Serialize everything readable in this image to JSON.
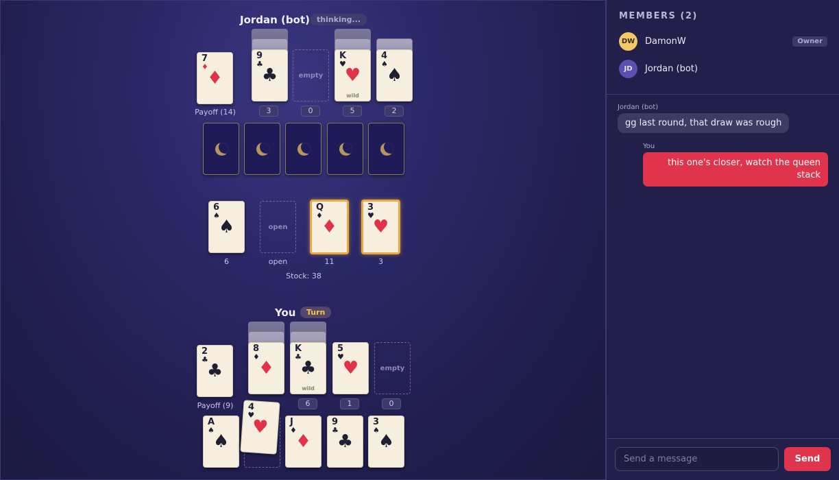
{
  "opponent": {
    "name": "Jordan (bot)",
    "status": "thinking...",
    "payoff_label": "Payoff (14)",
    "payoff_card": {
      "rank": "7",
      "suit": "♦",
      "color": "red"
    },
    "stacks": [
      {
        "rank": "9",
        "suit": "♣",
        "color": "black",
        "wild": "",
        "count": "3"
      },
      {
        "slot": "empty",
        "count": "0"
      },
      {
        "rank": "K",
        "suit": "♥",
        "color": "red",
        "wild": "wild",
        "count": "5"
      },
      {
        "rank": "4",
        "suit": "♠",
        "color": "black",
        "wild": "",
        "count": "2"
      }
    ],
    "hand_backs": 5,
    "back_icon": "crescent-moon-icon"
  },
  "build_piles": [
    {
      "rank": "6",
      "suit": "♠",
      "color": "black",
      "caption": "6"
    },
    {
      "slot": "open",
      "caption": "open"
    },
    {
      "rank": "Q",
      "suit": "♦",
      "color": "red",
      "caption": "11",
      "highlight": true
    },
    {
      "rank": "3",
      "suit": "♥",
      "color": "red",
      "caption": "3",
      "highlight": true
    }
  ],
  "stock_label": "Stock: 38",
  "player": {
    "name": "You",
    "status": "Turn",
    "payoff_label": "Payoff (9)",
    "payoff_card": {
      "rank": "2",
      "suit": "♣",
      "color": "black"
    },
    "stacks": [
      {
        "rank": "8",
        "suit": "♦",
        "color": "red",
        "wild": "",
        "count": ""
      },
      {
        "rank": "K",
        "suit": "♣",
        "color": "black",
        "wild": "wild",
        "count": "6"
      },
      {
        "rank": "5",
        "suit": "♥",
        "color": "red",
        "wild": "",
        "count": "1"
      },
      {
        "slot": "empty",
        "count": "0"
      }
    ],
    "hand": [
      {
        "rank": "A",
        "suit": "♠",
        "color": "black"
      },
      {
        "rank": "4",
        "suit": "♥",
        "color": "red",
        "dragging": true
      },
      {
        "rank": "J",
        "suit": "♦",
        "color": "red"
      },
      {
        "rank": "9",
        "suit": "♣",
        "color": "black"
      },
      {
        "rank": "3",
        "suit": "♠",
        "color": "black"
      }
    ]
  },
  "sidebar": {
    "members_title": "MEMBERS (2)",
    "members": [
      {
        "initials": "DW",
        "name": "DamonW",
        "badge": "Owner"
      },
      {
        "initials": "JD",
        "name": "Jordan (bot)",
        "badge": ""
      }
    ],
    "messages": [
      {
        "sender": "Jordan (bot)",
        "text": "gg last round, that draw was rough"
      },
      {
        "sender": "You",
        "text": "this one's closer, watch the queen stack"
      }
    ],
    "input_placeholder": "Send a message",
    "send_label": "Send"
  },
  "colors": {
    "accent": "#e0344c",
    "highlight": "#e9a93c",
    "turn": "#f5c542"
  }
}
